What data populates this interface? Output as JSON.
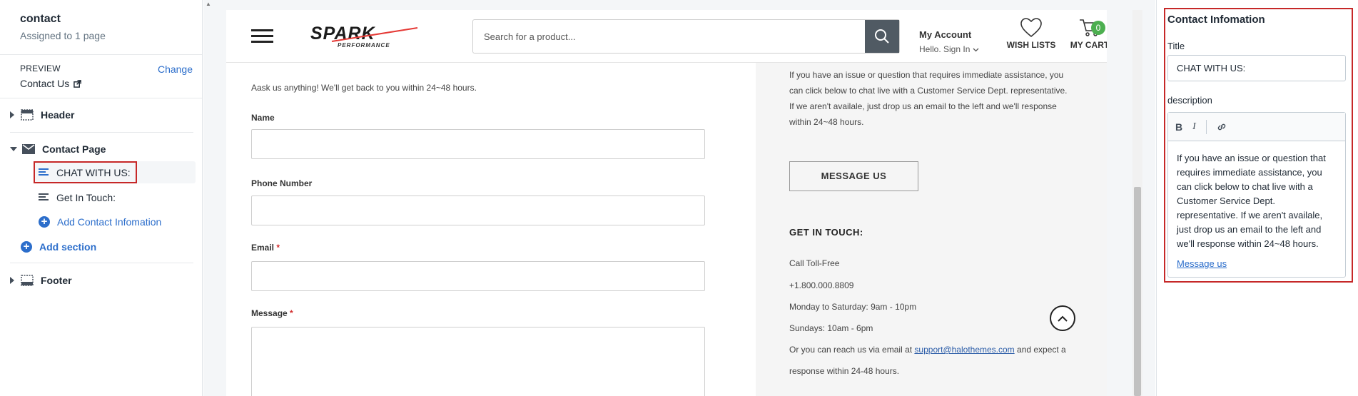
{
  "left_panel": {
    "title": "contact",
    "subtitle": "Assigned to 1 page",
    "preview_label": "PREVIEW",
    "preview_value": "Contact Us",
    "change_label": "Change",
    "sections": {
      "header": "Header",
      "contact_page": "Contact Page",
      "blocks": [
        "CHAT WITH US:",
        "Get In Touch:"
      ],
      "add_block": "Add Contact Infomation",
      "add_section": "Add section",
      "footer": "Footer"
    }
  },
  "preview": {
    "logo_text": "SPARK",
    "logo_sub": "PERFORMANCE",
    "search_placeholder": "Search for a product...",
    "account_title": "My Account",
    "account_sub": "Hello. Sign In",
    "wishlist_label": "WISH LISTS",
    "cart_label": "MY CART",
    "cart_count": "0",
    "form": {
      "intro": "Aask us anything! We'll get back to you within 24~48 hours.",
      "name_label": "Name",
      "phone_label": "Phone Number",
      "email_label": "Email",
      "message_label": "Message",
      "required_mark": "*"
    },
    "info": {
      "lines": [
        "If you have an issue or question that requires immediate assistance, you",
        "can click below to chat live with a Customer Service Dept. representative.",
        "If we aren't availale, just drop us an email to the left and we'll response",
        "within 24~48 hours."
      ],
      "button": "MESSAGE US",
      "get_in_touch": "GET IN TOUCH:",
      "call_label": "Call Toll-Free",
      "phone": "+1.800.000.8809",
      "hours_week": "Monday to Saturday: 9am - 10pm",
      "hours_sun": "Sundays: 10am - 6pm",
      "email_prefix": "Or you can reach us via email at",
      "email": "support@halothemes.com",
      "email_suffix": "and expect a",
      "response": "response within 24-48 hours."
    }
  },
  "right_panel": {
    "title": "Contact Infomation",
    "title_label": "Title",
    "title_value": "CHAT WITH US:",
    "description_label": "description",
    "toolbar": {
      "bold": "B",
      "italic": "I"
    },
    "description_text": "If you have an issue or question that requires immediate assistance, you can click below to chat live with a Customer Service Dept. representative. If we aren't availale, just drop us an email to the left and we'll response within 24~48 hours.",
    "description_link": "Message us"
  },
  "colors": {
    "accent": "#2c6ecb",
    "highlight": "#c62828",
    "badge": "#4caf50"
  }
}
